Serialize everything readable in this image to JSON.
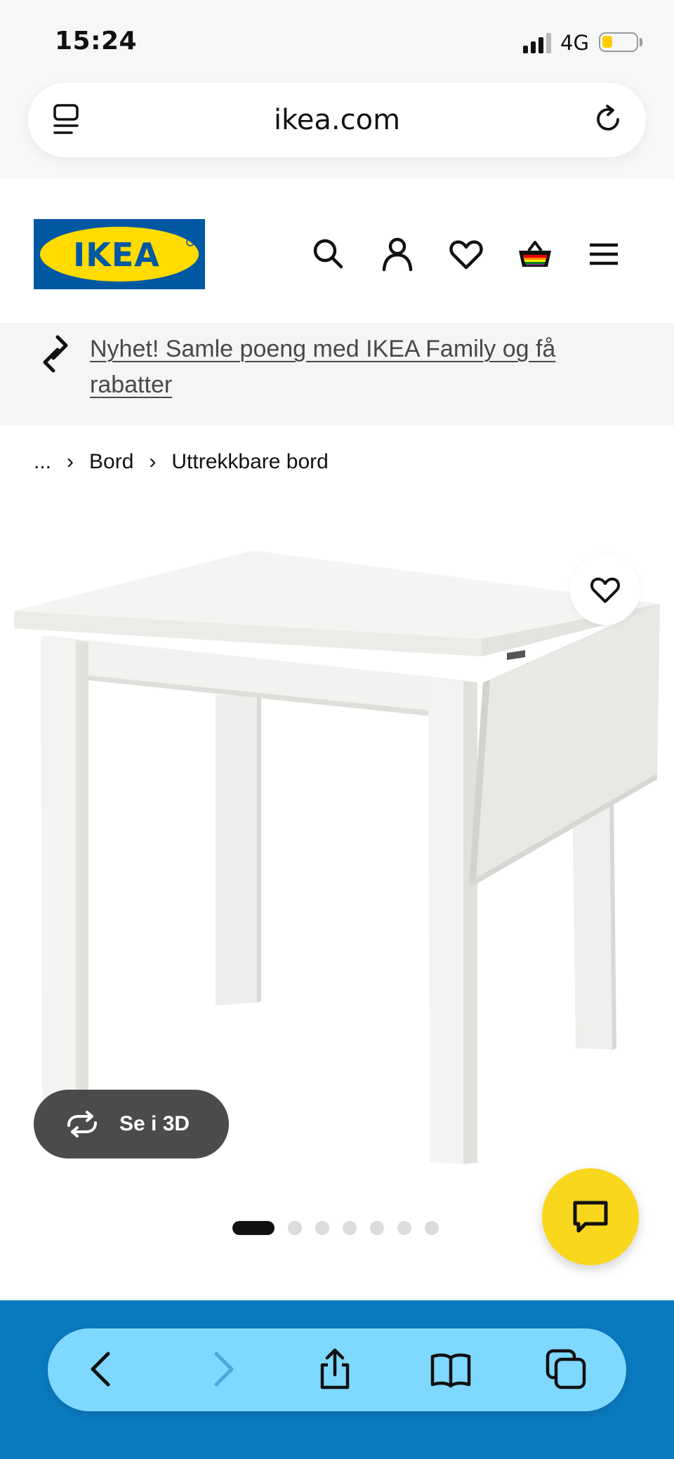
{
  "status_bar": {
    "time": "15:24",
    "network": "4G",
    "signal_bars_active": 3,
    "signal_bars_total": 4,
    "battery_level": 0.25,
    "battery_color": "#ffcc00"
  },
  "browser": {
    "url": "ikea.com"
  },
  "header": {
    "logo_text": "IKEA",
    "brand_colors": {
      "blue": "#0058a3",
      "yellow": "#ffdb00"
    },
    "icons": [
      "search-icon",
      "account-icon",
      "favorites-icon",
      "basket-icon",
      "menu-icon"
    ]
  },
  "promo": {
    "icon": "link-icon",
    "text": "Nyhet! Samle poeng med IKEA Family og få rabatter"
  },
  "breadcrumb": {
    "items": [
      "...",
      "Bord",
      "Uttrekkbare bord"
    ]
  },
  "product": {
    "image_icon": "drop-leaf-table-image",
    "view_3d_label": "Se i 3D",
    "image_count": 7,
    "current_image": 1
  },
  "chat": {
    "icon": "chat-icon",
    "color": "#f9d71c"
  },
  "toolbar": {
    "icons": [
      "back-icon",
      "forward-icon",
      "share-icon",
      "bookmarks-icon",
      "tabs-icon"
    ],
    "forward_enabled": false
  }
}
